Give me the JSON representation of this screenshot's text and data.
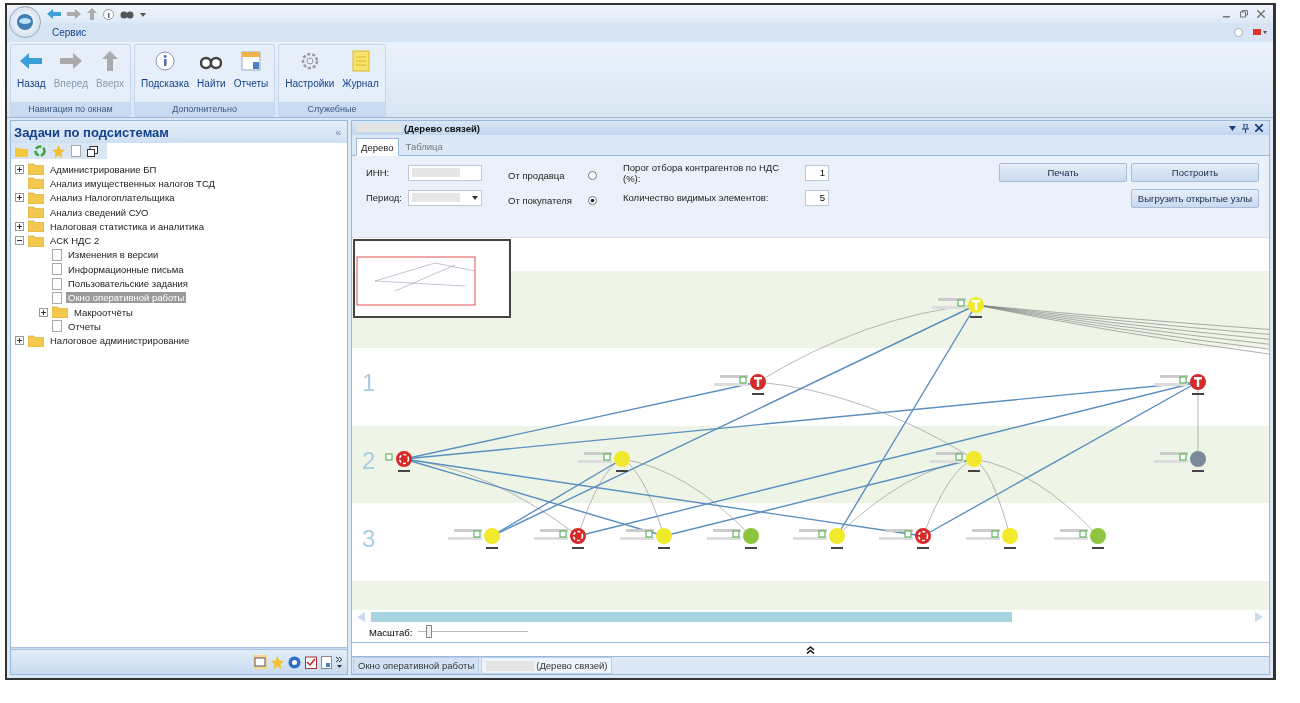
{
  "menu": {
    "tab": "Сервис"
  },
  "ribbon": [
    {
      "label": "Навигация по окнам",
      "buttons": [
        {
          "label": "Назад",
          "kind": "back",
          "disabled": false
        },
        {
          "label": "Вперед",
          "kind": "forward",
          "disabled": true
        },
        {
          "label": "Вверх",
          "kind": "up",
          "disabled": true
        }
      ]
    },
    {
      "label": "Дополнительно",
      "buttons": [
        {
          "label": "Подсказка",
          "kind": "info",
          "disabled": false
        },
        {
          "label": "Найти",
          "kind": "binoculars",
          "disabled": false
        },
        {
          "label": "Отчеты",
          "kind": "report",
          "disabled": false
        }
      ]
    },
    {
      "label": "Служебные",
      "buttons": [
        {
          "label": "Настройки",
          "kind": "gear",
          "disabled": false
        },
        {
          "label": "Журнал",
          "kind": "journal",
          "disabled": false
        }
      ]
    }
  ],
  "left_panel": {
    "title": "Задачи по подсистемам",
    "collapse": "«",
    "tree": [
      {
        "label": "Администрирование БП",
        "kind": "folder",
        "expanded": false,
        "selected": false
      },
      {
        "label": "Анализ имущественных налогов ТСД",
        "kind": "folder",
        "selected": false
      },
      {
        "label": "Анализ Налогоплательщика",
        "kind": "folder",
        "expanded": false,
        "selected": false
      },
      {
        "label": "Анализ сведений СУО",
        "kind": "folder",
        "selected": false
      },
      {
        "label": "Налоговая статистика и аналитика",
        "kind": "folder",
        "expanded": false,
        "selected": false
      },
      {
        "label": "АСК НДС 2",
        "kind": "folder",
        "expanded": true,
        "selected": false,
        "children": [
          {
            "label": "Изменения в версии",
            "kind": "document",
            "selected": false
          },
          {
            "label": "Информационные письма",
            "kind": "document",
            "selected": false
          },
          {
            "label": "Пользовательские задания",
            "kind": "document",
            "selected": false
          },
          {
            "label": "Окно оперативной работы",
            "kind": "document",
            "selected": true
          },
          {
            "label": "Макроотчёты",
            "kind": "folder",
            "expanded": false,
            "selected": false
          },
          {
            "label": "Отчеты",
            "kind": "document",
            "selected": false
          }
        ]
      },
      {
        "label": "Налоговое администрирование",
        "kind": "folder",
        "expanded": false,
        "selected": false
      }
    ]
  },
  "document": {
    "title": "(Дерево связей)",
    "tabs": [
      {
        "label": "Дерево",
        "selected": true
      },
      {
        "label": "Таблица",
        "selected": false
      }
    ],
    "form": {
      "inn_label": "ИНН:",
      "period_label": "Период:",
      "radios": [
        {
          "label": "От продавца",
          "selected": false
        },
        {
          "label": "От покупателя",
          "selected": true
        }
      ],
      "fields": [
        {
          "label": "Порог отбора контрагентов по НДС (%):",
          "value": "1"
        },
        {
          "label": "Количество видимых элементов:",
          "value": "5"
        }
      ],
      "buttons": [
        "Печать",
        "Построить",
        "Выгрузить открытые узлы"
      ]
    },
    "graph": {
      "level_labels": [
        "1",
        "2",
        "3"
      ]
    },
    "zoom": {
      "label": "Масштаб:",
      "level": 0.1
    }
  },
  "bottom_tabs": [
    {
      "label": "Окно оперативной работы",
      "selected": false
    },
    {
      "label": "(Дерево связей)",
      "selected": true
    }
  ]
}
